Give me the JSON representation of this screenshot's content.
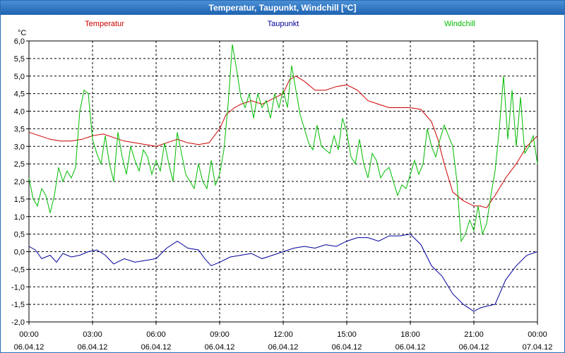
{
  "window": {
    "title": "Temperatur, Taupunkt, Windchill [°C]"
  },
  "chart_data": {
    "type": "line",
    "title": "Temperatur, Taupunkt, Windchill [°C]",
    "unit": "°C",
    "ylim": [
      -2.0,
      6.0
    ],
    "yticks": [
      "6,0",
      "5,5",
      "5,0",
      "4,5",
      "4,0",
      "3,5",
      "3,0",
      "2,5",
      "2,0",
      "1,5",
      "1,0",
      "0,5",
      "0,0",
      "-0,5",
      "-1,0",
      "-1,5",
      "-2,0"
    ],
    "xlim_hours": [
      0,
      24
    ],
    "xticks": [
      {
        "time": "00:00",
        "date": "06.04.12"
      },
      {
        "time": "03:00",
        "date": "06.04.12"
      },
      {
        "time": "06:00",
        "date": "06.04.12"
      },
      {
        "time": "09:00",
        "date": "06.04.12"
      },
      {
        "time": "12:00",
        "date": "06.04.12"
      },
      {
        "time": "15:00",
        "date": "06.04.12"
      },
      {
        "time": "18:00",
        "date": "06.04.12"
      },
      {
        "time": "21:00",
        "date": "06.04.12"
      },
      {
        "time": "00:00",
        "date": "07.04.12"
      }
    ],
    "grid": true,
    "legend_position": "top",
    "series": [
      {
        "name": "Temperatur",
        "color": "#cc0000",
        "x_hours": [
          0,
          0.5,
          1,
          1.5,
          2,
          2.5,
          3,
          3.5,
          4,
          4.5,
          5,
          5.5,
          6,
          6.5,
          7,
          7.5,
          8,
          8.5,
          9,
          9.3,
          9.7,
          10,
          10.5,
          11,
          11.5,
          12,
          12.3,
          12.6,
          13,
          13.5,
          14,
          14.5,
          15,
          15.5,
          16,
          16.5,
          17,
          17.5,
          18,
          18.5,
          19,
          19.3,
          19.6,
          20,
          20.5,
          21,
          21.3,
          21.6,
          22,
          22.5,
          23,
          23.5,
          24
        ],
        "values": [
          3.4,
          3.3,
          3.2,
          3.15,
          3.15,
          3.2,
          3.3,
          3.35,
          3.25,
          3.15,
          3.1,
          3.05,
          3.0,
          3.1,
          3.2,
          3.1,
          3.05,
          3.1,
          3.5,
          3.9,
          4.1,
          4.2,
          4.3,
          4.2,
          4.35,
          4.5,
          4.9,
          5.0,
          4.85,
          4.6,
          4.6,
          4.7,
          4.75,
          4.6,
          4.3,
          4.2,
          4.1,
          4.1,
          4.1,
          4.05,
          3.7,
          3.2,
          2.5,
          1.7,
          1.45,
          1.3,
          1.3,
          1.25,
          1.6,
          2.1,
          2.5,
          3.0,
          3.3
        ]
      },
      {
        "name": "Taupunkt",
        "color": "#00009a",
        "x_hours": [
          0,
          0.3,
          0.6,
          1,
          1.3,
          1.6,
          2,
          2.4,
          2.8,
          3.2,
          3.6,
          4,
          4.5,
          5,
          5.5,
          6,
          6.5,
          7,
          7.5,
          8,
          8.3,
          8.6,
          9,
          9.5,
          10,
          10.5,
          11,
          11.5,
          12,
          12.5,
          13,
          13.5,
          14,
          14.5,
          15,
          15.5,
          16,
          16.5,
          17,
          17.5,
          18,
          18.5,
          19,
          19.5,
          20,
          20.5,
          21,
          21.3,
          21.6,
          22,
          22.5,
          23,
          23.5,
          24
        ],
        "values": [
          0.15,
          0.05,
          -0.2,
          -0.1,
          -0.3,
          -0.05,
          -0.15,
          -0.1,
          0.0,
          0.05,
          -0.1,
          -0.35,
          -0.2,
          -0.3,
          -0.25,
          -0.2,
          0.1,
          0.3,
          0.1,
          0.05,
          -0.2,
          -0.4,
          -0.3,
          -0.15,
          -0.1,
          -0.05,
          -0.2,
          -0.1,
          0.0,
          0.1,
          0.15,
          0.1,
          0.2,
          0.15,
          0.3,
          0.4,
          0.4,
          0.3,
          0.45,
          0.45,
          0.5,
          0.2,
          -0.4,
          -0.7,
          -1.2,
          -1.5,
          -1.7,
          -1.6,
          -1.55,
          -1.5,
          -0.8,
          -0.4,
          -0.1,
          0.0
        ]
      },
      {
        "name": "Windchill",
        "color": "#00bb00",
        "x_hours": [
          0,
          0.2,
          0.4,
          0.6,
          0.8,
          1,
          1.2,
          1.4,
          1.6,
          1.8,
          2,
          2.2,
          2.4,
          2.6,
          2.8,
          3,
          3.2,
          3.4,
          3.6,
          3.8,
          4,
          4.2,
          4.4,
          4.6,
          4.8,
          5,
          5.2,
          5.4,
          5.6,
          5.8,
          6,
          6.2,
          6.4,
          6.6,
          6.8,
          7,
          7.2,
          7.4,
          7.6,
          7.8,
          8,
          8.2,
          8.4,
          8.6,
          8.8,
          9,
          9.2,
          9.4,
          9.6,
          9.8,
          10,
          10.2,
          10.4,
          10.6,
          10.8,
          11,
          11.2,
          11.4,
          11.6,
          11.8,
          12,
          12.2,
          12.4,
          12.6,
          12.8,
          13,
          13.2,
          13.4,
          13.6,
          13.8,
          14,
          14.2,
          14.4,
          14.6,
          14.8,
          15,
          15.2,
          15.4,
          15.6,
          15.8,
          16,
          16.2,
          16.4,
          16.6,
          16.8,
          17,
          17.2,
          17.4,
          17.6,
          17.8,
          18,
          18.2,
          18.4,
          18.6,
          18.8,
          19,
          19.2,
          19.4,
          19.6,
          19.8,
          20,
          20.2,
          20.4,
          20.6,
          20.8,
          21,
          21.2,
          21.4,
          21.6,
          21.8,
          22,
          22.2,
          22.4,
          22.6,
          22.8,
          23,
          23.2,
          23.4,
          23.6,
          23.8,
          24
        ],
        "values": [
          2.1,
          1.5,
          1.3,
          1.8,
          1.6,
          1.1,
          1.6,
          2.4,
          2.0,
          2.3,
          2.1,
          2.4,
          4.0,
          4.6,
          4.5,
          3.2,
          2.8,
          2.5,
          3.3,
          2.5,
          2.0,
          3.4,
          2.7,
          2.2,
          3.0,
          2.6,
          2.3,
          2.9,
          2.7,
          2.2,
          2.6,
          2.3,
          3.1,
          2.5,
          2.0,
          3.4,
          2.8,
          2.2,
          2.0,
          1.8,
          2.5,
          2.0,
          1.8,
          2.6,
          1.9,
          2.2,
          2.9,
          4.2,
          5.9,
          5.2,
          4.4,
          4.1,
          4.5,
          3.8,
          4.5,
          4.1,
          4.3,
          3.8,
          4.5,
          4.1,
          4.6,
          4.1,
          5.3,
          4.6,
          3.9,
          3.5,
          3.1,
          2.9,
          3.6,
          3.0,
          2.9,
          2.8,
          3.3,
          2.9,
          3.8,
          3.4,
          2.7,
          2.5,
          3.2,
          2.5,
          2.1,
          2.8,
          2.6,
          2.1,
          2.3,
          2.4,
          2.0,
          1.6,
          1.9,
          1.8,
          2.2,
          2.6,
          2.2,
          2.5,
          3.5,
          3.0,
          2.7,
          3.2,
          3.6,
          3.3,
          3.0,
          2.0,
          0.3,
          0.5,
          0.9,
          0.6,
          1.3,
          0.5,
          0.8,
          1.6,
          2.3,
          3.5,
          5.0,
          3.2,
          4.6,
          3.0,
          4.4,
          2.8,
          3.0,
          3.3,
          2.5,
          2.4
        ]
      }
    ]
  }
}
